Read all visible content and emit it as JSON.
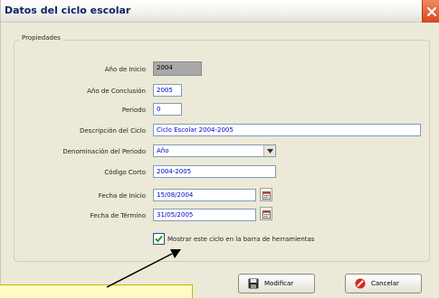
{
  "window": {
    "title": "Datos del ciclo escolar",
    "close_icon": "close-x-icon"
  },
  "group": {
    "legend": "Propiedades"
  },
  "form": {
    "anio_inicio": {
      "label": "Año de Inicio",
      "value": "2004"
    },
    "anio_conclusion": {
      "label": "Año de Conclusión",
      "value": "2005"
    },
    "periodo": {
      "label": "Periodo",
      "value": "0"
    },
    "descripcion": {
      "label": "Descripción del Ciclo",
      "value": "Ciclo Escolar 2004-2005"
    },
    "denominacion": {
      "label": "Denominación del Periodo",
      "value": "Año"
    },
    "codigo_corto": {
      "label": "Código Corto",
      "value": "2004-2005"
    },
    "fecha_inicio": {
      "label": "Fecha de Inicio",
      "value": "15/08/2004"
    },
    "fecha_termino": {
      "label": "Fecha de Término",
      "value": "31/05/2005"
    }
  },
  "checkbox": {
    "label": "Mostrar este ciclo en la barra de herramientas",
    "checked": true
  },
  "buttons": {
    "modificar": "Modificar",
    "cancelar": "Cancelar"
  },
  "colors": {
    "field_text": "#0000cc",
    "title_text": "#0a246a",
    "close_button": "#d8471e",
    "callout_bg": "#fffcc4"
  }
}
